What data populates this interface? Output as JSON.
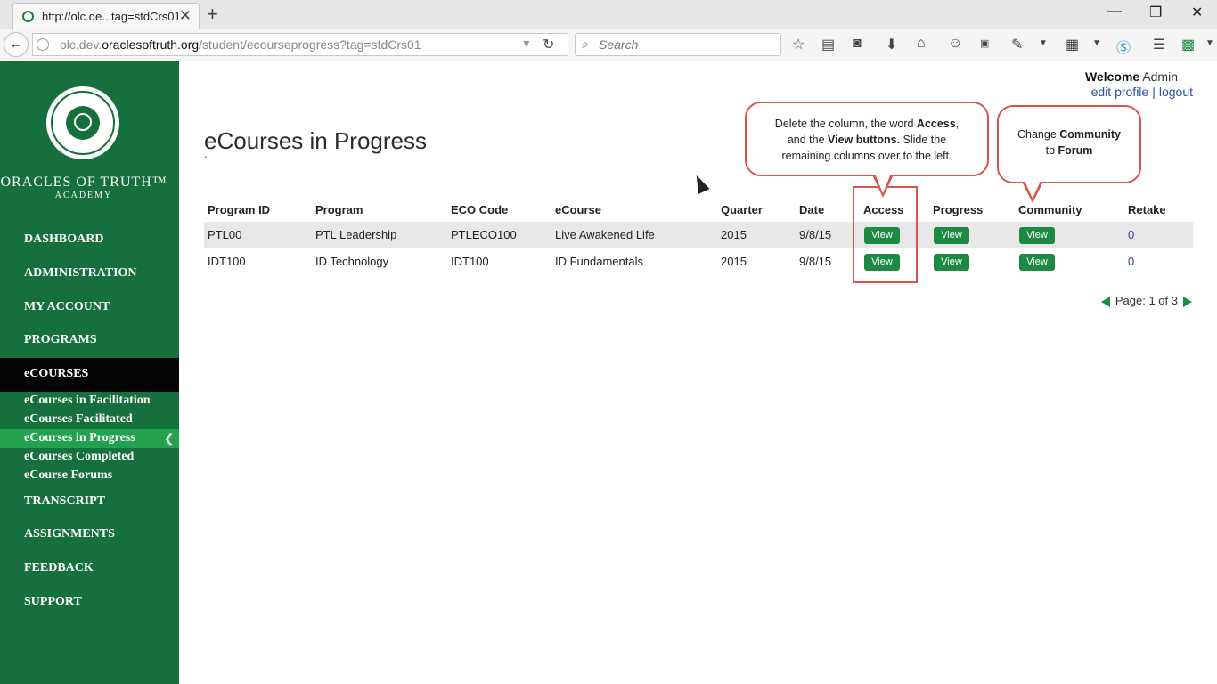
{
  "browser": {
    "tab_title": "http://olc.de...tag=stdCrs01",
    "url_prefix": "olc.dev.",
    "url_domain": "oraclesoftruth.org",
    "url_path": "/student/ecourseprogress?tag=stdCrs01",
    "search_placeholder": "Search"
  },
  "sidebar": {
    "brand_line1": "ORACLES OF TRUTH™",
    "brand_line2": "ACADEMY",
    "nav": [
      "DASHBOARD",
      "ADMINISTRATION",
      "MY ACCOUNT",
      "PROGRAMS",
      "eCOURSES",
      "TRANSCRIPT",
      "ASSIGNMENTS",
      "FEEDBACK",
      "SUPPORT"
    ],
    "sub_nav": [
      "eCourses in Facilitation",
      "eCourses Facilitated",
      "eCourses in Progress",
      "eCourses Completed",
      "eCourse Forums"
    ]
  },
  "header": {
    "welcome_label": "Welcome",
    "user": "Admin",
    "edit_profile": "edit profile",
    "separator": "|",
    "logout": "logout"
  },
  "main": {
    "title": "eCourses in Progress",
    "subtitle": ".",
    "table": {
      "headers": [
        "Program ID",
        "Program",
        "ECO Code",
        "eCourse",
        "Quarter",
        "Date",
        "Access",
        "Progress",
        "Community",
        "Retake"
      ],
      "rows": [
        {
          "program_id": "PTL00",
          "program": "PTL Leadership",
          "eco_code": "PTLECO100",
          "ecourse": "Live Awakened Life",
          "quarter": "2015",
          "date": "9/8/15",
          "access": "View",
          "progress": "View",
          "community": "View",
          "retake": "0"
        },
        {
          "program_id": "IDT100",
          "program": "ID Technology",
          "eco_code": "IDT100",
          "ecourse": "ID Fundamentals",
          "quarter": "2015",
          "date": "9/8/15",
          "access": "View",
          "progress": "View",
          "community": "View",
          "retake": "0"
        }
      ]
    },
    "pager": "Page: 1 of 3"
  },
  "annotations": {
    "callout1": {
      "l1_a": "Delete the column, the word ",
      "l1_b": "Access",
      "l1_c": ",",
      "l2_a": "and the ",
      "l2_b": "View buttons.",
      "l2_c": " Slide the",
      "l3": "remaining columns over to the left."
    },
    "callout2": {
      "l1_a": "Change ",
      "l1_b": "Community",
      "l2_a": "to ",
      "l2_b": "Forum"
    }
  },
  "colors": {
    "sidebar": "#16703c",
    "active_nav": "#050505",
    "active_sub": "#22a14f",
    "button": "#1c8a43",
    "callout_border": "#d9534f"
  }
}
